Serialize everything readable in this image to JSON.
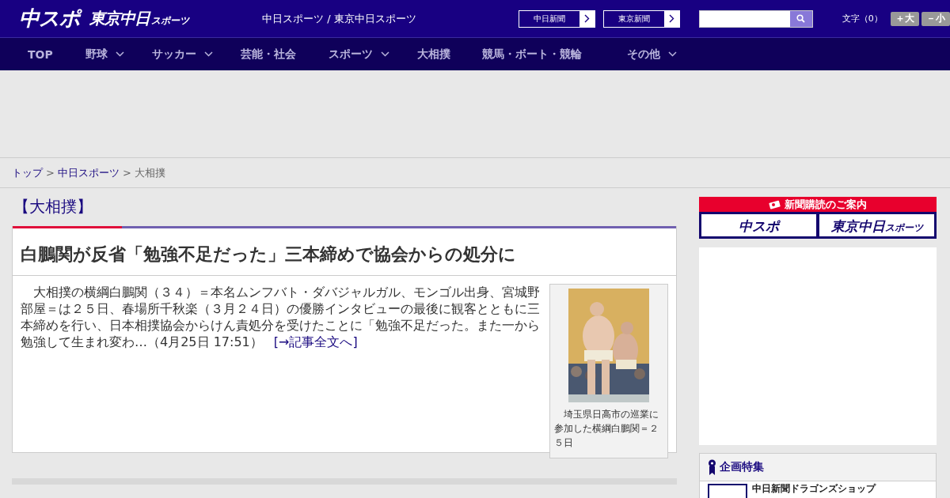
{
  "header": {
    "logo_main": "中スポ",
    "logo_sub": "東京中日",
    "logo_sub_small": "スポーツ",
    "site_title": "中日スポーツ / 東京中日スポーツ",
    "paper_links": [
      {
        "label": "中日新聞"
      },
      {
        "label": "東京新聞"
      }
    ],
    "font_size_label": "文字（0）",
    "font_buttons": [
      {
        "label": "＋大"
      },
      {
        "label": "－小"
      }
    ]
  },
  "nav": [
    {
      "label": "TOP",
      "dropdown": false
    },
    {
      "label": "野球",
      "dropdown": true
    },
    {
      "label": "サッカー",
      "dropdown": true
    },
    {
      "label": "芸能・社会",
      "dropdown": false
    },
    {
      "label": "スポーツ",
      "dropdown": true
    },
    {
      "label": "大相撲",
      "dropdown": false
    },
    {
      "label": "競馬・ボート・競輪",
      "dropdown": false
    },
    {
      "label": "その他",
      "dropdown": true
    }
  ],
  "breadcrumb": [
    {
      "label": "トップ",
      "link": true
    },
    {
      "separator": ">",
      "label": "中日スポーツ",
      "link": true
    },
    {
      "separator": ">",
      "label": "大相撲",
      "link": false
    }
  ],
  "category": "【大相撲】",
  "article": {
    "headline": "白鵬関が反省「勉強不足だった」三本締めで協会からの処分に",
    "body": "　大相撲の横綱白鵬関（３４）＝本名ムンフバト・ダバジャルガル、モンゴル出身、宮城野部屋＝は２５日、春場所千秋楽（３月２４日）の優勝インタビューの最後に観客とともに三本締めを行い、日本相撲協会からけん責処分を受けたことに「勉強不足だった。また一から勉強して生まれ変わ…（4月25日 17:51）",
    "read_more": "[→記事全文へ]",
    "photo": {
      "kind": "picture",
      "caption": "　埼玉県日高市の巡業に参加した横綱白鵬関＝２５日"
    }
  },
  "sidebar": {
    "subscribe_title": "新聞購読のご案内",
    "subscribe_logos": [
      {
        "main": "中スポ"
      },
      {
        "main": "東京中日",
        "small": "スポーツ"
      }
    ],
    "feature_title": "企画特集",
    "feature_items": [
      {
        "label": "中日新聞ドラゴンズショップ"
      }
    ]
  }
}
